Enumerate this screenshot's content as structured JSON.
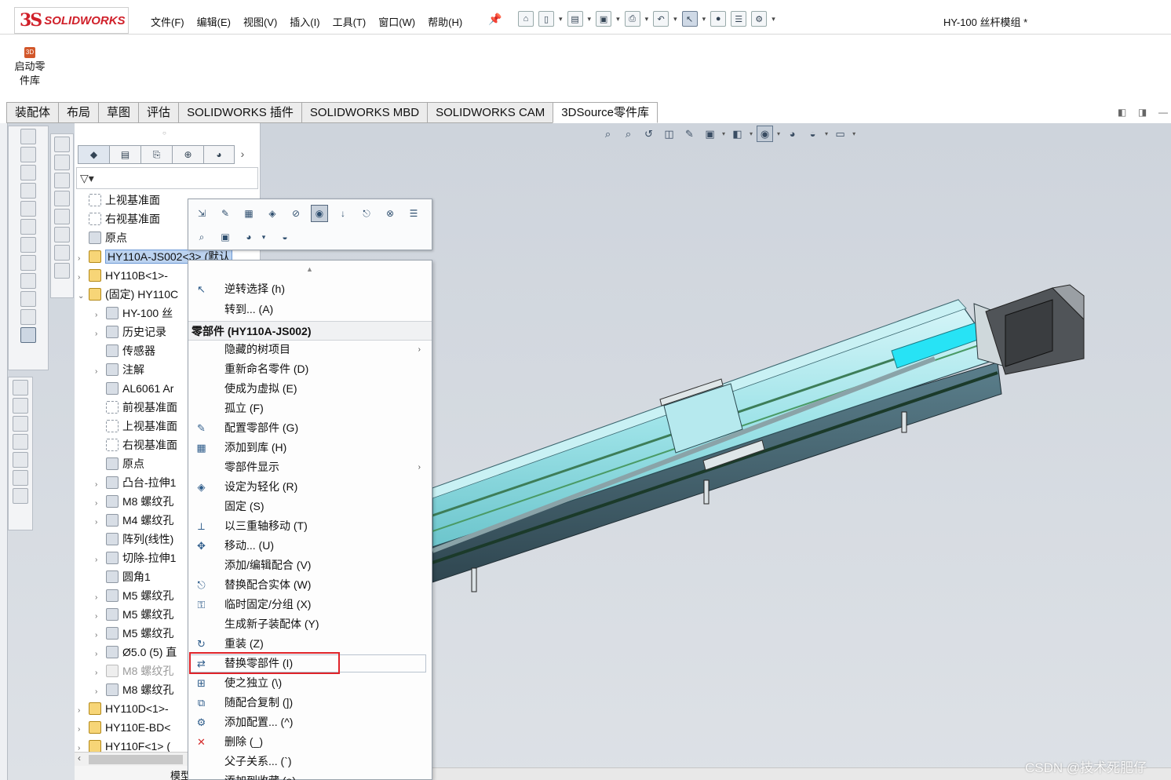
{
  "app": {
    "logo_mark": "3S",
    "logo_text": "SOLIDWORKS",
    "document_title": "HY-100 丝杆模组 *"
  },
  "menu": [
    "文件(F)",
    "编辑(E)",
    "视图(V)",
    "插入(I)",
    "工具(T)",
    "窗口(W)",
    "帮助(H)"
  ],
  "ribbon": {
    "launch_label_1": "启动零",
    "launch_label_2": "件库",
    "launch_icon": "3D"
  },
  "tabs": [
    "装配体",
    "布局",
    "草图",
    "评估",
    "SOLIDWORKS 插件",
    "SOLIDWORKS MBD",
    "SOLIDWORKS CAM",
    "3DSource零件库"
  ],
  "tree": {
    "filter_label": "▽▾",
    "items": [
      {
        "label": "上视基准面",
        "type": "plane"
      },
      {
        "label": "右视基准面",
        "type": "plane"
      },
      {
        "label": "原点",
        "type": "origin"
      },
      {
        "label": "HY110A-JS002<3> (默认",
        "type": "asm",
        "selected": true
      },
      {
        "label": "HY110B<1>-",
        "type": "asm"
      },
      {
        "label": "(固定) HY110C",
        "type": "asm"
      },
      {
        "label": "HY-100 丝",
        "type": "feat"
      },
      {
        "label": "历史记录",
        "type": "feat"
      },
      {
        "label": "传感器",
        "type": "feat"
      },
      {
        "label": "注解",
        "type": "feat"
      },
      {
        "label": "AL6061 Ar",
        "type": "feat"
      },
      {
        "label": "前视基准面",
        "type": "plane"
      },
      {
        "label": "上视基准面",
        "type": "plane"
      },
      {
        "label": "右视基准面",
        "type": "plane"
      },
      {
        "label": "原点",
        "type": "origin"
      },
      {
        "label": "凸台-拉伸1",
        "type": "feat"
      },
      {
        "label": "M8 螺纹孔",
        "type": "feat"
      },
      {
        "label": "M4 螺纹孔",
        "type": "feat"
      },
      {
        "label": "阵列(线性)",
        "type": "feat"
      },
      {
        "label": "切除-拉伸1",
        "type": "feat"
      },
      {
        "label": "圆角1",
        "type": "feat"
      },
      {
        "label": "M5 螺纹孔",
        "type": "feat"
      },
      {
        "label": "M5 螺纹孔",
        "type": "feat"
      },
      {
        "label": "M5 螺纹孔",
        "type": "feat"
      },
      {
        "label": "Ø5.0 (5) 直",
        "type": "feat"
      },
      {
        "label": "M8 螺纹孔",
        "type": "grey"
      },
      {
        "label": "M8 螺纹孔",
        "type": "feat"
      },
      {
        "label": "HY110D<1>-",
        "type": "asm"
      },
      {
        "label": "HY110E-BD<",
        "type": "asm"
      },
      {
        "label": "HY110F<1> (",
        "type": "asm"
      }
    ],
    "bottom_label": "模型"
  },
  "context_menu": {
    "header": "零部件 (HY110A-JS002)",
    "top_items": [
      {
        "label": "逆转选择 (h)",
        "icon": "cursor-icon"
      },
      {
        "label": "转到... (A)",
        "icon": ""
      }
    ],
    "items": [
      {
        "label": "隐藏的树项目",
        "icon": "",
        "submenu": true
      },
      {
        "label": "重新命名零件 (D)",
        "icon": ""
      },
      {
        "label": "使成为虚拟 (E)",
        "icon": ""
      },
      {
        "label": "孤立 (F)",
        "icon": ""
      },
      {
        "label": "配置零部件 (G)",
        "icon": "pencil-icon"
      },
      {
        "label": "添加到库 (H)",
        "icon": "library-icon"
      },
      {
        "label": "零部件显示",
        "icon": "",
        "submenu": true
      },
      {
        "label": "设定为轻化 (R)",
        "icon": "feather-icon"
      },
      {
        "label": "固定 (S)",
        "icon": ""
      },
      {
        "label": "以三重轴移动 (T)",
        "icon": "triad-icon"
      },
      {
        "label": "移动... (U)",
        "icon": "move-icon"
      },
      {
        "label": "添加/编辑配合 (V)",
        "icon": ""
      },
      {
        "label": "替换配合实体 (W)",
        "icon": "mate-icon"
      },
      {
        "label": "临时固定/分组 (X)",
        "icon": "lock-icon"
      },
      {
        "label": "生成新子装配体 (Y)",
        "icon": ""
      },
      {
        "label": "重装 (Z)",
        "icon": "reload-icon"
      },
      {
        "label": "替换零部件 (I)",
        "icon": "replace-icon"
      },
      {
        "label": "使之独立 (\\)",
        "icon": "independent-icon"
      },
      {
        "label": "随配合复制 (])",
        "icon": "copy-icon"
      },
      {
        "label": "添加配置... (^)",
        "icon": "config-icon"
      },
      {
        "label": "删除 (_)",
        "icon": "delete-icon"
      },
      {
        "label": "父子关系... (`)",
        "icon": ""
      },
      {
        "label": "添加到收藏 (a)",
        "icon": ""
      }
    ]
  },
  "watermark": "CSDN @技术死肥仔",
  "colors": {
    "brand": "#d0202a",
    "highlight": "#e0242a",
    "selection": "#bcd3f0"
  }
}
